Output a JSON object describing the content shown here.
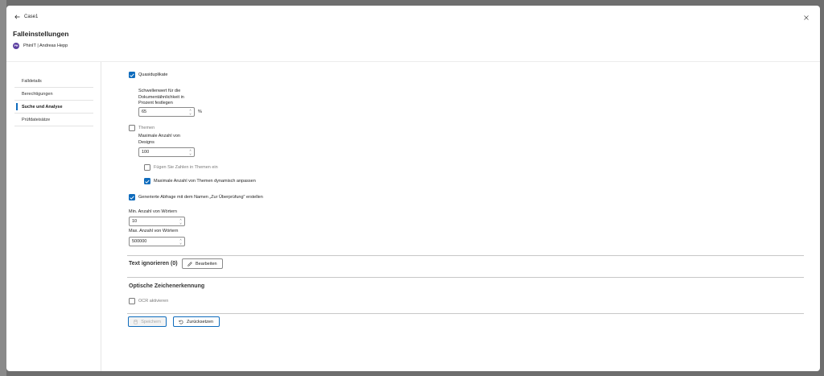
{
  "header": {
    "back_label": "Case1",
    "title": "Falleinstellungen",
    "org_avatar_text": "PH",
    "org_label": "PhinIT | Andreas Hepp"
  },
  "sidebar": {
    "items": [
      {
        "label": "Falldetails",
        "active": false
      },
      {
        "label": "Berechtigungen",
        "active": false
      },
      {
        "label": "Suche und Analyse",
        "active": true
      },
      {
        "label": "Prüfdateisätze",
        "active": false
      }
    ]
  },
  "settings": {
    "quasi_duplicates": {
      "label": "Quasiduplikate",
      "checked": true
    },
    "threshold": {
      "label_line1": "Schwellenwert für die",
      "label_line2": "Dokumentähnlichkeit in",
      "label_line3": "Prozent festlegen",
      "value": "65",
      "unit": "%"
    },
    "themes": {
      "label": "Themen",
      "checked": false
    },
    "max_designs": {
      "label_line1": "Maximale Anzahl von",
      "label_line2": "Designs",
      "value": "100"
    },
    "add_numbers": {
      "label": "Fügen Sie Zahlen in Themen ein",
      "checked": false
    },
    "dynamic_adjust": {
      "label": "Maximale Anzahl von Themen dynamisch anpassen",
      "checked": true
    },
    "generated_query": {
      "label": "Generierte Abfrage mit dem Namen „Zur Überprüfung\" erstellen",
      "checked": true
    },
    "min_words": {
      "label": "Min. Anzahl von Wörtern",
      "value": "10"
    },
    "max_words": {
      "label": "Max. Anzahl von Wörtern",
      "value": "500000"
    }
  },
  "ignore_text": {
    "title": "Text ignorieren (0)",
    "edit_label": "Bearbeiten"
  },
  "ocr": {
    "title": "Optische Zeichenerkennung",
    "enable_label": "OCR aktivieren",
    "checked": false
  },
  "footer": {
    "save_label": "Speichern",
    "reset_label": "Zurücksetzen"
  },
  "colors": {
    "accent": "#0f6cbd",
    "avatar": "#5b3fa0"
  }
}
